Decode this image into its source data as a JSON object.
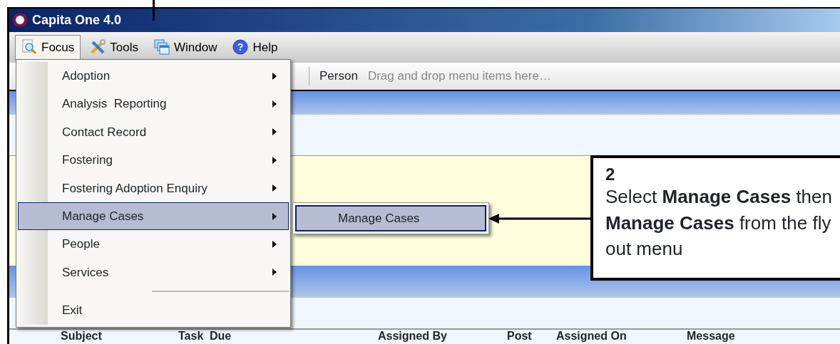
{
  "window": {
    "title": "Capita One 4.0"
  },
  "menu_bar": [
    {
      "label": "Focus",
      "selected": true
    },
    {
      "label": "Tools",
      "selected": false
    },
    {
      "label": "Window",
      "selected": false
    },
    {
      "label": "Help",
      "icon_glyph": "?",
      "selected": false
    }
  ],
  "toolbar": {
    "label": "Person",
    "drop_hint": "Drag and drop menu items here…"
  },
  "focus_menu": {
    "items": [
      {
        "kind": "item",
        "label": "Adoption",
        "has_submenu": true,
        "selected": false
      },
      {
        "kind": "item",
        "label": "Analysis  Reporting",
        "has_submenu": true,
        "selected": false
      },
      {
        "kind": "item",
        "label": "Contact Record",
        "has_submenu": true,
        "selected": false
      },
      {
        "kind": "item",
        "label": "Fostering",
        "has_submenu": true,
        "selected": false
      },
      {
        "kind": "item",
        "label": "Fostering Adoption Enquiry",
        "has_submenu": true,
        "selected": false
      },
      {
        "kind": "item",
        "label": "Manage Cases",
        "has_submenu": true,
        "selected": true
      },
      {
        "kind": "item",
        "label": "People",
        "has_submenu": true,
        "selected": false
      },
      {
        "kind": "item",
        "label": "Services",
        "has_submenu": true,
        "selected": false
      },
      {
        "kind": "separator"
      },
      {
        "kind": "item",
        "label": "Exit",
        "has_submenu": false,
        "selected": false
      }
    ]
  },
  "submenu": {
    "items": [
      {
        "label": "Manage Cases",
        "selected": true
      }
    ]
  },
  "table": {
    "columns": [
      "Subject",
      "Task",
      "Due",
      "Assigned By",
      "Post",
      "Assigned On",
      "Message"
    ]
  },
  "callout": {
    "step": "2",
    "text": "Select **Manage Cases** then **Manage Cases** from the fly out menu"
  }
}
